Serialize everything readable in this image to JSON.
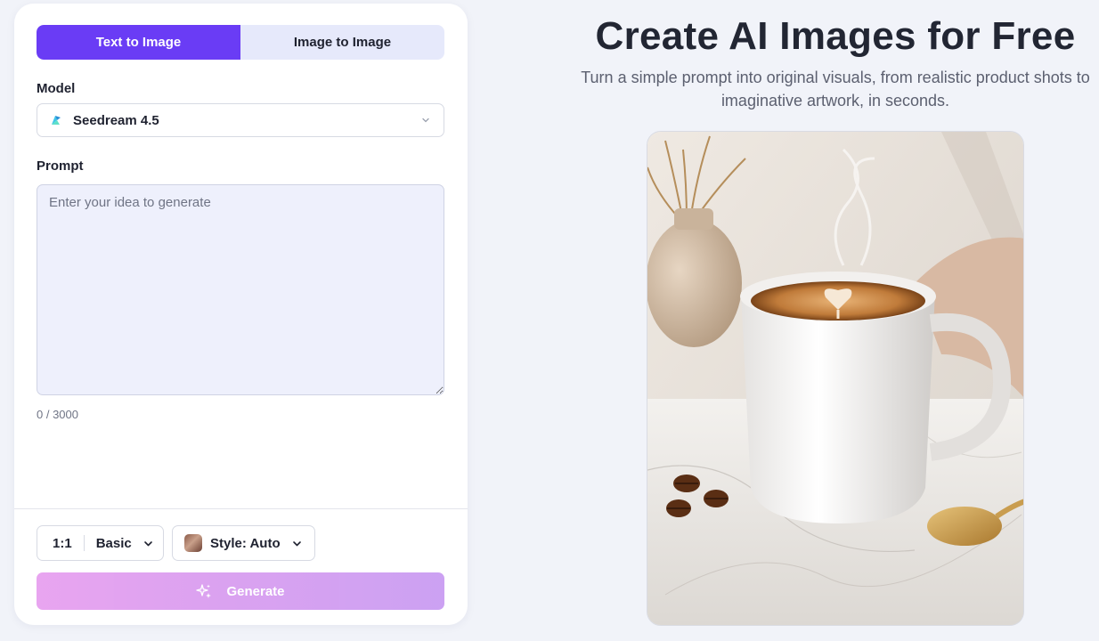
{
  "tabs": [
    {
      "label": "Text to Image",
      "active": true
    },
    {
      "label": "Image to Image",
      "active": false
    }
  ],
  "model": {
    "label": "Model",
    "selected": "Seedream 4.5",
    "icon": "seedream-model-icon"
  },
  "prompt": {
    "label": "Prompt",
    "placeholder": "Enter your idea to generate",
    "value": "",
    "counter": "0 / 3000"
  },
  "options": {
    "ratio": "1:1",
    "quality": "Basic",
    "style": "Style: Auto"
  },
  "generate": {
    "label": "Generate",
    "icon": "sparkle-icon"
  },
  "hero": {
    "title": "Create AI Images for Free",
    "subtitle": "Turn a simple prompt into original visuals, from realistic product shots to imaginative artwork, in seconds."
  },
  "showcase": {
    "icon": "coffee-cup-illustration"
  },
  "colors": {
    "accent": "#6a3cf5",
    "tab_bg": "#e6e9fb",
    "generate_start": "#e7a0ef",
    "generate_end": "#c99cf2",
    "page_bg": "#f1f3f9"
  }
}
